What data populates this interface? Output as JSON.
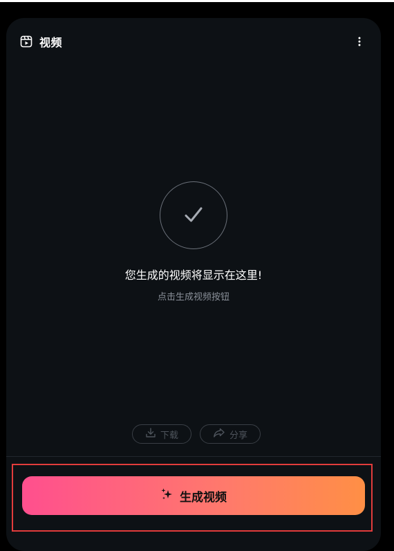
{
  "header": {
    "title": "视频",
    "icon": "video-icon",
    "more_icon": "more-vertical-icon"
  },
  "empty_state": {
    "icon": "check-icon",
    "title": "您生成的视频将显示在这里!",
    "subtitle": "点击生成视频按钮"
  },
  "actions": {
    "download_label": "下载",
    "download_icon": "download-icon",
    "share_label": "分享",
    "share_icon": "share-icon"
  },
  "generate": {
    "label": "生成视频",
    "icon": "sparkle-icon",
    "gradient_start": "#ff4f8e",
    "gradient_end": "#ff8f45"
  },
  "colors": {
    "card_background": "#0d1115",
    "highlight_border": "#e23c3c"
  }
}
